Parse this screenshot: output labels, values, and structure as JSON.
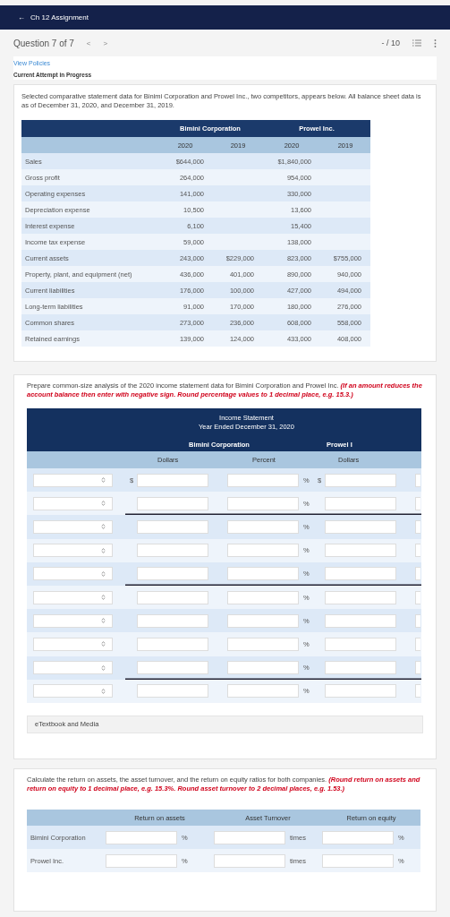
{
  "header": {
    "back_icon": "←",
    "title": "Ch 12 Assignment"
  },
  "question": {
    "label": "Question 7 of 7",
    "prev": "<",
    "next": ">",
    "score": "- / 10"
  },
  "policies_link": "View Policies",
  "attempt_status": "Current Attempt in Progress",
  "data_card": {
    "intro": "Selected comparative statement data for Binimi Corporation and Prowel Inc., two competitors, appears below. All balance sheet data is as of December 31, 2020, and December 31, 2019.",
    "group_headers": [
      "Bimini Corporation",
      "Prowel Inc."
    ],
    "year_headers": [
      "2020",
      "2019",
      "2020",
      "2019"
    ],
    "rows": [
      {
        "label": "Sales",
        "bimini_2020": "$644,000",
        "prowel_2020": "$1,840,000"
      },
      {
        "label": "Gross profit",
        "bimini_2020": "264,000",
        "prowel_2020": "954,000"
      },
      {
        "label": "Operating expenses",
        "bimini_2020": "141,000",
        "prowel_2020": "330,000"
      },
      {
        "label": "Depreciation expense",
        "bimini_2020": "10,500",
        "prowel_2020": "13,600"
      },
      {
        "label": "Interest expense",
        "bimini_2020": "6,100",
        "prowel_2020": "15,400"
      },
      {
        "label": "Income tax expense",
        "bimini_2020": "59,000",
        "prowel_2020": "138,000"
      },
      {
        "label": "Current assets",
        "bimini_2020": "243,000",
        "bimini_2019": "$229,000",
        "prowel_2020": "823,000",
        "prowel_2019": "$755,000"
      },
      {
        "label": "Property, plant, and equipment (net)",
        "bimini_2020": "436,000",
        "bimini_2019": "401,000",
        "prowel_2020": "890,000",
        "prowel_2019": "940,000"
      },
      {
        "label": "Current liabilities",
        "bimini_2020": "176,000",
        "bimini_2019": "100,000",
        "prowel_2020": "427,000",
        "prowel_2019": "494,000"
      },
      {
        "label": "Long-term liabilities",
        "bimini_2020": "91,000",
        "bimini_2019": "170,000",
        "prowel_2020": "180,000",
        "prowel_2019": "276,000"
      },
      {
        "label": "Common shares",
        "bimini_2020": "273,000",
        "bimini_2019": "236,000",
        "prowel_2020": "608,000",
        "prowel_2019": "558,000"
      },
      {
        "label": "Retained earnings",
        "bimini_2020": "139,000",
        "bimini_2019": "124,000",
        "prowel_2020": "433,000",
        "prowel_2019": "408,000"
      }
    ]
  },
  "common_size_card": {
    "instruction": "Prepare common-size analysis of the 2020 income statement data for Bimini Corporation and Prowel Inc. *(If an amount reduces the account balance then enter with negative sign. Round percentage values to 1 decimal place, e.g. 15.3.)*",
    "title": "Income Statement",
    "subtitle": "Year Ended December 31, 2020",
    "group_headers": [
      "Bimini Corporation",
      "Prowel I"
    ],
    "column_headers": [
      "Dollars",
      "Percent",
      "Dollars"
    ],
    "rows": [
      {
        "currency_sign": "$",
        "percent_sign": "%",
        "rule_below": false
      },
      {
        "percent_sign": "%",
        "rule_below": true
      },
      {
        "percent_sign": "%",
        "rule_below": false
      },
      {
        "percent_sign": "%",
        "rule_below": false
      },
      {
        "percent_sign": "%",
        "rule_below": true
      },
      {
        "percent_sign": "%",
        "rule_below": false
      },
      {
        "percent_sign": "%",
        "rule_below": false
      },
      {
        "percent_sign": "%",
        "rule_below": false
      },
      {
        "percent_sign": "%",
        "rule_below": true
      },
      {
        "percent_sign": "%",
        "rule_below": false
      }
    ],
    "etextbook": "eTextbook and Media"
  },
  "ratio_card": {
    "instruction": "Calculate the return on assets, the asset turnover, and the return on equity ratios for both companies. *(Round return on assets and return on equity to 1 decimal place, e.g. 15.3%. Round asset turnover to 2 decimal places, e.g. 1.53.)*",
    "columns": [
      "Return on assets",
      "Asset Turnover",
      "Return on equity"
    ],
    "rows": [
      {
        "label": "Bimini Corporation",
        "units": [
          "%",
          "times",
          "%"
        ]
      },
      {
        "label": "Prowel Inc.",
        "units": [
          "%",
          "times",
          "%"
        ]
      }
    ]
  }
}
